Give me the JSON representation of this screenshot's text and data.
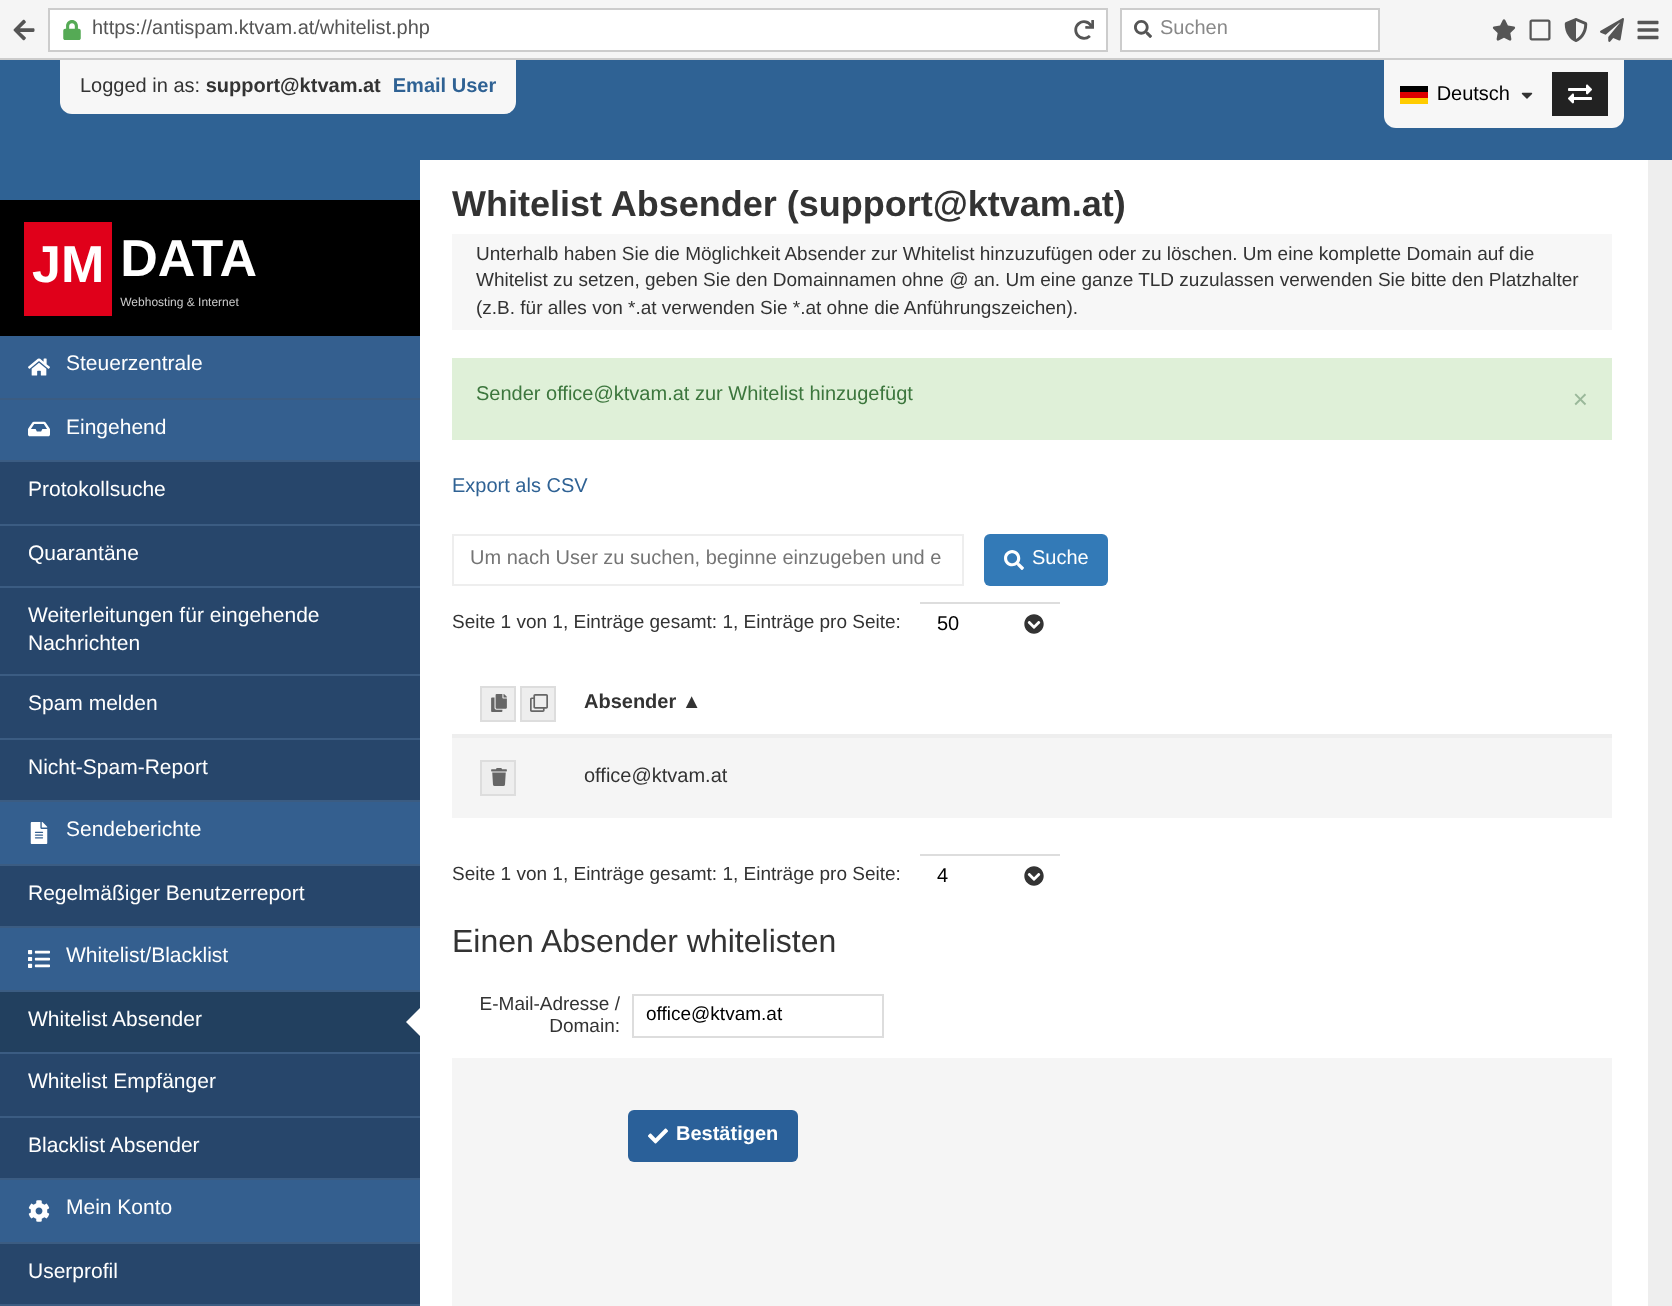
{
  "browser": {
    "url": "https://antispam.ktvam.at/whitelist.php",
    "search_placeholder": "Suchen"
  },
  "topbar": {
    "user_label": "Logged in as:",
    "user_email": "support@ktvam.at",
    "email_user_link": "Email User",
    "language": "Deutsch"
  },
  "logo": {
    "mark": "JM",
    "name": "DATA",
    "tagline": "Webhosting & Internet"
  },
  "sidebar": {
    "items": [
      {
        "label": "Steuerzentrale",
        "kind": "section",
        "selected": false
      },
      {
        "label": "Eingehend",
        "kind": "section",
        "selected": false
      },
      {
        "label": "Protokollsuche",
        "kind": "item",
        "selected": false
      },
      {
        "label": "Quarantäne",
        "kind": "item",
        "selected": false
      },
      {
        "label": "Weiterleitungen für eingehende Nachrichten",
        "kind": "item",
        "selected": false
      },
      {
        "label": "Spam melden",
        "kind": "item",
        "selected": false
      },
      {
        "label": "Nicht-Spam-Report",
        "kind": "item",
        "selected": false
      },
      {
        "label": "Sendeberichte",
        "kind": "section",
        "selected": false
      },
      {
        "label": "Regelmäßiger Benutzerreport",
        "kind": "item",
        "selected": false
      },
      {
        "label": "Whitelist/Blacklist",
        "kind": "section",
        "selected": false
      },
      {
        "label": "Whitelist Absender",
        "kind": "item",
        "selected": true
      },
      {
        "label": "Whitelist Empfänger",
        "kind": "item",
        "selected": false
      },
      {
        "label": "Blacklist Absender",
        "kind": "item",
        "selected": false
      },
      {
        "label": "Mein Konto",
        "kind": "section",
        "selected": false
      },
      {
        "label": "Userprofil",
        "kind": "item",
        "selected": false
      }
    ]
  },
  "page": {
    "title": "Whitelist Absender (support@ktvam.at)",
    "intro": "Unterhalb haben Sie die Möglichkeit Absender zur Whitelist hinzuzufügen oder zu löschen. Um eine komplette Domain auf die Whitelist zu setzen, geben Sie den Domainnamen ohne @ an. Um eine ganze TLD zuzulassen verwenden Sie bitte den Platzhalter (z.B. für alles von *.at verwenden Sie *.at ohne die Anführungszeichen).",
    "alert": {
      "text": "Sender office@ktvam.at zur Whitelist hinzugefügt",
      "close": "×"
    },
    "export_link": "Export als CSV",
    "search": {
      "placeholder": "Um nach User zu suchen, beginne einzugeben und e",
      "button": "Suche"
    },
    "pager_top": {
      "text": "Seite 1 von 1, Einträge gesamt: 1, Einträge pro Seite:",
      "per_page": "50"
    },
    "table": {
      "columns": [
        "Absender ▲"
      ],
      "rows": [
        {
          "cells": [
            "office@ktvam.at"
          ]
        }
      ]
    },
    "pager_bottom": {
      "text": "Seite 1 von 1, Einträge gesamt: 1, Einträge pro Seite:",
      "per_page": "4"
    },
    "form": {
      "title": "Einen Absender whitelisten",
      "label": "E-Mail-Adresse / Domain:",
      "value": "office@ktvam.at",
      "submit": "Bestätigen"
    }
  }
}
